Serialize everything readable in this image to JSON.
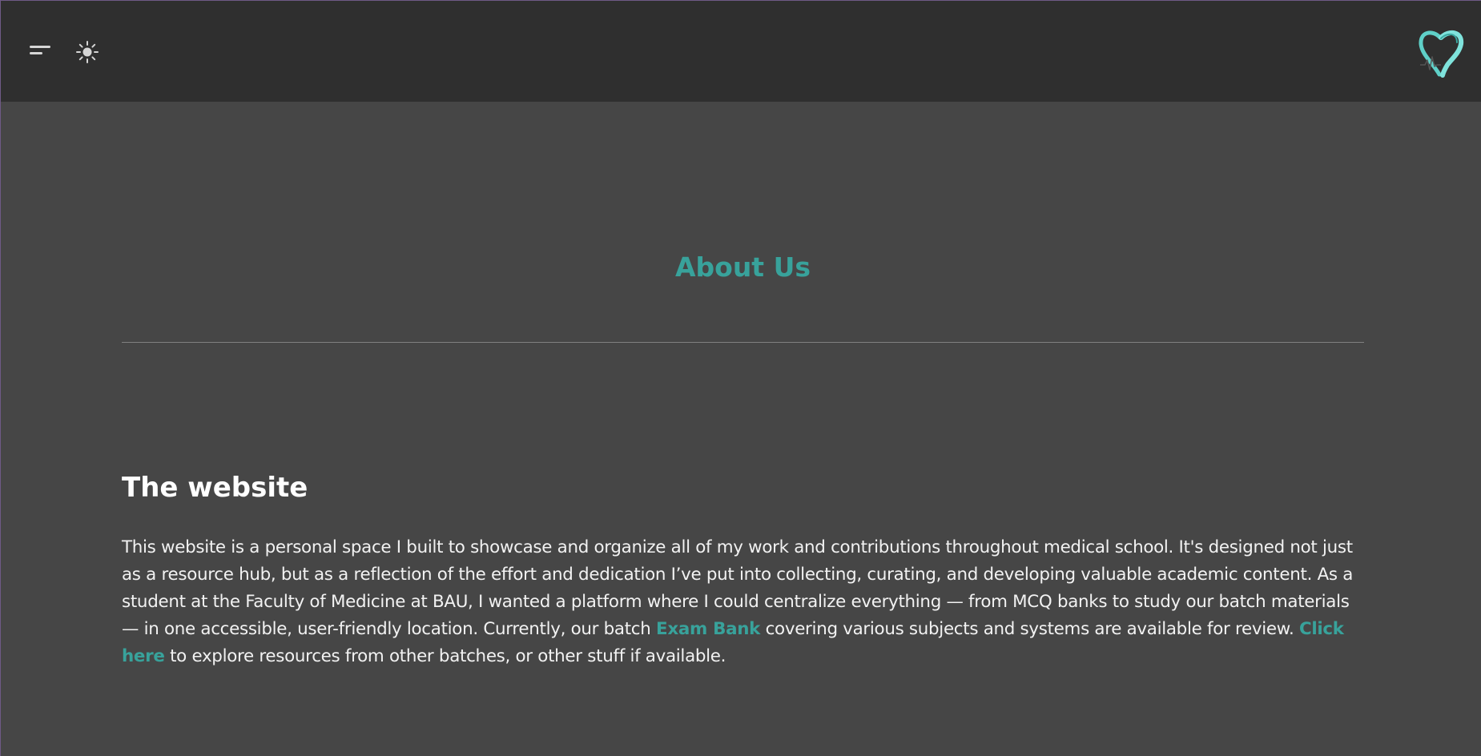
{
  "header": {
    "menu_icon": "menu-icon",
    "theme_icon": "sun-icon",
    "logo_icon": "heart-logo-icon"
  },
  "colors": {
    "header_bg": "#2f2f2f",
    "page_bg": "#464646",
    "accent": "#38a29b",
    "text": "#f2f2f2"
  },
  "main": {
    "title": "About Us",
    "section": {
      "heading": "The website",
      "body_part1": "This website is a personal space I built to showcase and organize all of my work and contributions throughout medical school. It's designed not just as a resource hub, but as a reflection of the effort and dedication I’ve put into collecting, curating, and developing valuable academic content. As a student at the Faculty of Medicine at BAU, I wanted a platform where I could centralize everything — from MCQ banks to study our batch materials — in one accessible, user-friendly location. Currently, our batch ",
      "exam_bank_link": "Exam Bank",
      "body_part2": " covering various subjects and systems are available for review. ",
      "click_here_link": "Click here",
      "body_part3": " to explore resources from other batches, or other stuff if available."
    }
  }
}
